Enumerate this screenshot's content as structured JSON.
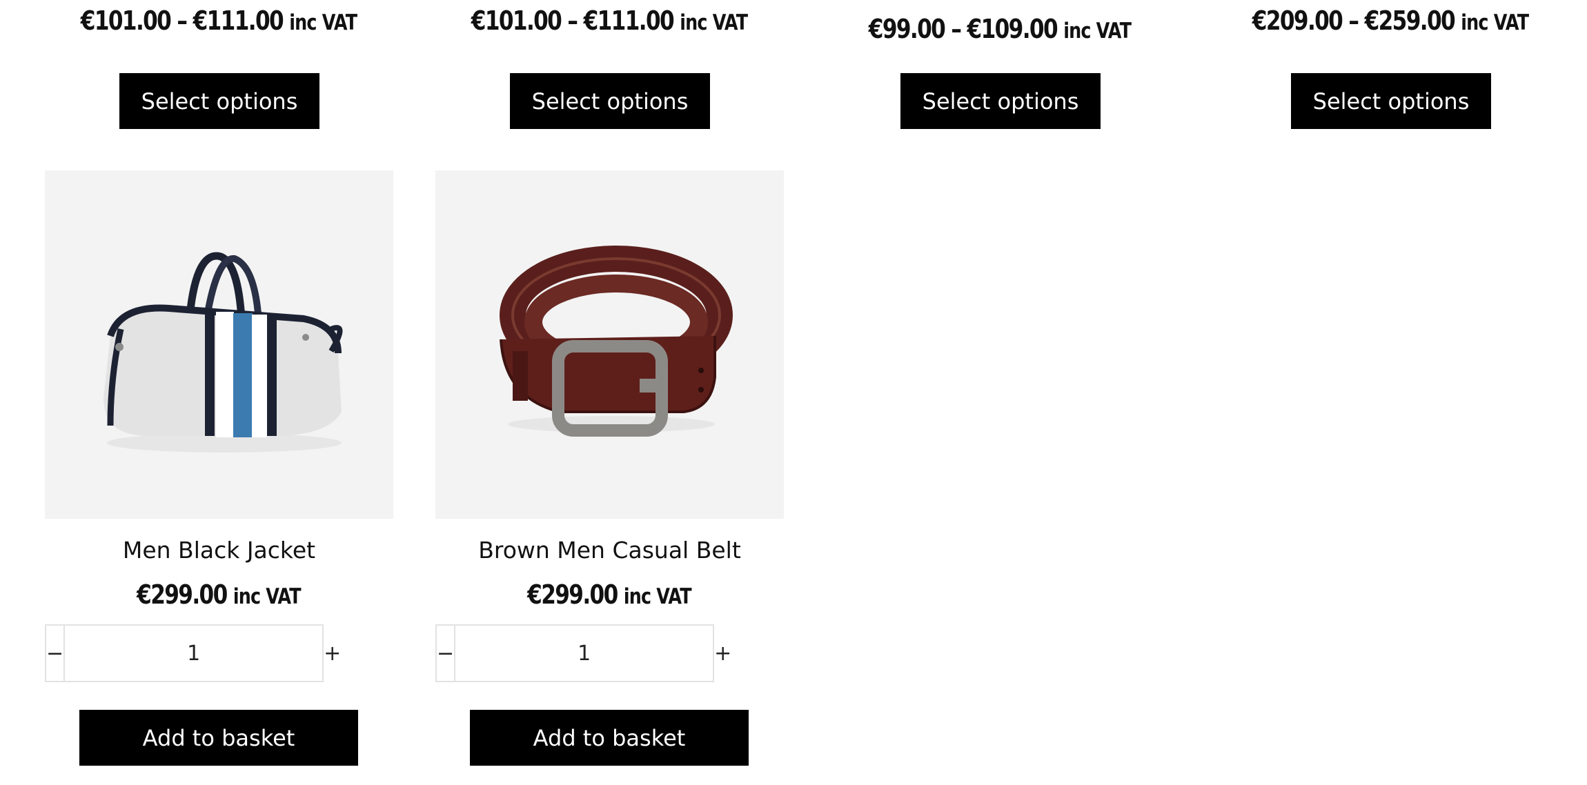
{
  "row_top": {
    "products": [
      {
        "price": "€101.00 – €111.00",
        "vat": "inc VAT",
        "button_label": "Select options"
      },
      {
        "price": "€101.00 – €111.00",
        "vat": "inc VAT",
        "button_label": "Select options"
      },
      {
        "price": "€99.00 – €109.00",
        "vat": "inc VAT",
        "button_label": "Select options"
      },
      {
        "price": "€209.00 – €259.00",
        "vat": "inc VAT",
        "button_label": "Select options"
      }
    ]
  },
  "row_bottom": {
    "products": [
      {
        "title": "Men Black Jacket",
        "price": "€299.00",
        "vat": "inc VAT",
        "quantity": "1",
        "minus_symbol": "−",
        "plus_symbol": "+",
        "button_label": "Add to basket",
        "image": "duffel-bag-image"
      },
      {
        "title": "Brown Men Casual Belt",
        "price": "€299.00",
        "vat": "inc VAT",
        "quantity": "1",
        "minus_symbol": "−",
        "plus_symbol": "+",
        "button_label": "Add to basket",
        "image": "leather-belt-image"
      }
    ]
  },
  "colors": {
    "button_bg": "#000000",
    "image_bg": "#f3f3f3",
    "border": "#e2e2e2",
    "bag_stripe": "#3b7bb0",
    "belt_leather": "#5a1f1c"
  }
}
